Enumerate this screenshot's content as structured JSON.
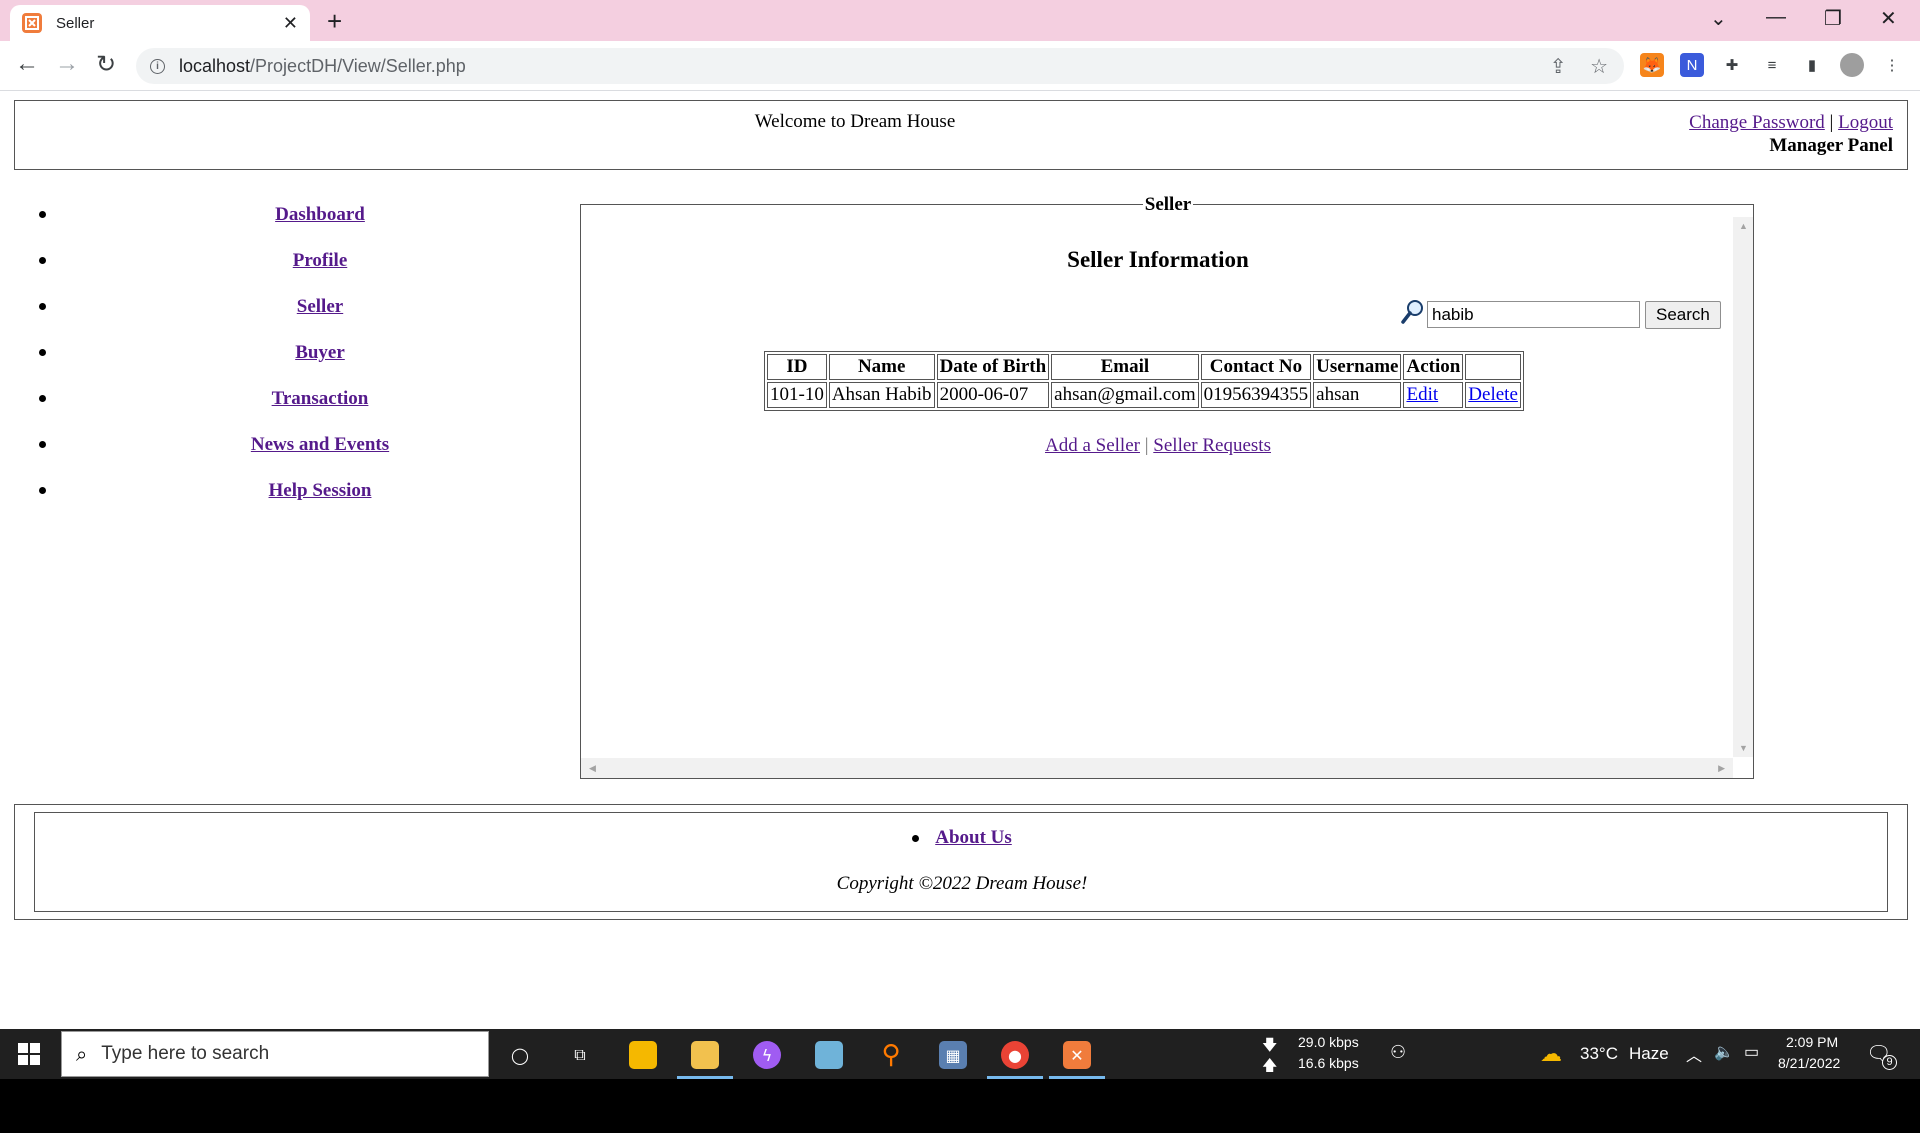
{
  "browser": {
    "tab_title": "Seller",
    "url_host": "localhost",
    "url_path": "/ProjectDH/View/Seller.php"
  },
  "header": {
    "welcome": "Welcome to Dream House",
    "change_password": "Change Password",
    "separator": "|",
    "logout": "Logout",
    "panel_label": "Manager Panel"
  },
  "sidebar": {
    "items": [
      {
        "label": "Dashboard"
      },
      {
        "label": "Profile"
      },
      {
        "label": "Seller"
      },
      {
        "label": "Buyer"
      },
      {
        "label": "Transaction"
      },
      {
        "label": "News and Events"
      },
      {
        "label": "Help Session"
      }
    ]
  },
  "main": {
    "legend": "Seller",
    "title": "Seller Information",
    "search": {
      "value": "habib",
      "button": "Search"
    },
    "table": {
      "headers": [
        "ID",
        "Name",
        "Date of Birth",
        "Email",
        "Contact No",
        "Username",
        "Action"
      ],
      "rows": [
        {
          "id": "101-10",
          "name": "Ahsan Habib",
          "dob": "2000-06-07",
          "email": "ahsan@gmail.com",
          "contact": "01956394355",
          "username": "ahsan",
          "edit": "Edit",
          "delete": "Delete"
        }
      ]
    },
    "add_seller": "Add a Seller",
    "separator": "|",
    "seller_requests": "Seller Requests"
  },
  "footer": {
    "about": "About Us",
    "copyright": "Copyright ©2022 Dream House!"
  },
  "taskbar": {
    "search_placeholder": "Type here to search",
    "download_speed": "29.0 kbps",
    "upload_speed": "16.6 kbps",
    "weather_temp": "33°C",
    "weather_desc": "Haze",
    "time": "2:09 PM",
    "date": "8/21/2022",
    "notification_count": "9"
  }
}
